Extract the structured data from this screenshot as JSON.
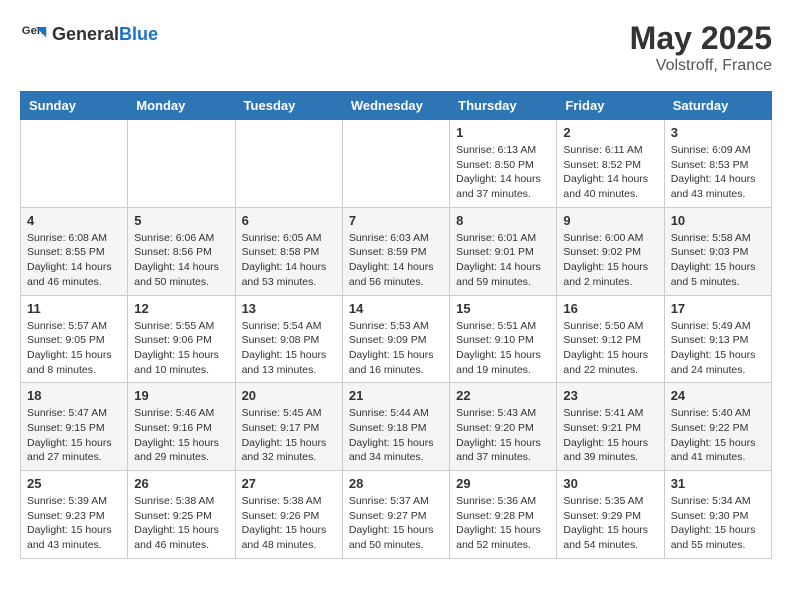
{
  "header": {
    "logo_general": "General",
    "logo_blue": "Blue",
    "month": "May 2025",
    "location": "Volstroff, France"
  },
  "weekdays": [
    "Sunday",
    "Monday",
    "Tuesday",
    "Wednesday",
    "Thursday",
    "Friday",
    "Saturday"
  ],
  "weeks": [
    [
      {
        "day": "",
        "info": ""
      },
      {
        "day": "",
        "info": ""
      },
      {
        "day": "",
        "info": ""
      },
      {
        "day": "",
        "info": ""
      },
      {
        "day": "1",
        "info": "Sunrise: 6:13 AM\nSunset: 8:50 PM\nDaylight: 14 hours and 37 minutes."
      },
      {
        "day": "2",
        "info": "Sunrise: 6:11 AM\nSunset: 8:52 PM\nDaylight: 14 hours and 40 minutes."
      },
      {
        "day": "3",
        "info": "Sunrise: 6:09 AM\nSunset: 8:53 PM\nDaylight: 14 hours and 43 minutes."
      }
    ],
    [
      {
        "day": "4",
        "info": "Sunrise: 6:08 AM\nSunset: 8:55 PM\nDaylight: 14 hours and 46 minutes."
      },
      {
        "day": "5",
        "info": "Sunrise: 6:06 AM\nSunset: 8:56 PM\nDaylight: 14 hours and 50 minutes."
      },
      {
        "day": "6",
        "info": "Sunrise: 6:05 AM\nSunset: 8:58 PM\nDaylight: 14 hours and 53 minutes."
      },
      {
        "day": "7",
        "info": "Sunrise: 6:03 AM\nSunset: 8:59 PM\nDaylight: 14 hours and 56 minutes."
      },
      {
        "day": "8",
        "info": "Sunrise: 6:01 AM\nSunset: 9:01 PM\nDaylight: 14 hours and 59 minutes."
      },
      {
        "day": "9",
        "info": "Sunrise: 6:00 AM\nSunset: 9:02 PM\nDaylight: 15 hours and 2 minutes."
      },
      {
        "day": "10",
        "info": "Sunrise: 5:58 AM\nSunset: 9:03 PM\nDaylight: 15 hours and 5 minutes."
      }
    ],
    [
      {
        "day": "11",
        "info": "Sunrise: 5:57 AM\nSunset: 9:05 PM\nDaylight: 15 hours and 8 minutes."
      },
      {
        "day": "12",
        "info": "Sunrise: 5:55 AM\nSunset: 9:06 PM\nDaylight: 15 hours and 10 minutes."
      },
      {
        "day": "13",
        "info": "Sunrise: 5:54 AM\nSunset: 9:08 PM\nDaylight: 15 hours and 13 minutes."
      },
      {
        "day": "14",
        "info": "Sunrise: 5:53 AM\nSunset: 9:09 PM\nDaylight: 15 hours and 16 minutes."
      },
      {
        "day": "15",
        "info": "Sunrise: 5:51 AM\nSunset: 9:10 PM\nDaylight: 15 hours and 19 minutes."
      },
      {
        "day": "16",
        "info": "Sunrise: 5:50 AM\nSunset: 9:12 PM\nDaylight: 15 hours and 22 minutes."
      },
      {
        "day": "17",
        "info": "Sunrise: 5:49 AM\nSunset: 9:13 PM\nDaylight: 15 hours and 24 minutes."
      }
    ],
    [
      {
        "day": "18",
        "info": "Sunrise: 5:47 AM\nSunset: 9:15 PM\nDaylight: 15 hours and 27 minutes."
      },
      {
        "day": "19",
        "info": "Sunrise: 5:46 AM\nSunset: 9:16 PM\nDaylight: 15 hours and 29 minutes."
      },
      {
        "day": "20",
        "info": "Sunrise: 5:45 AM\nSunset: 9:17 PM\nDaylight: 15 hours and 32 minutes."
      },
      {
        "day": "21",
        "info": "Sunrise: 5:44 AM\nSunset: 9:18 PM\nDaylight: 15 hours and 34 minutes."
      },
      {
        "day": "22",
        "info": "Sunrise: 5:43 AM\nSunset: 9:20 PM\nDaylight: 15 hours and 37 minutes."
      },
      {
        "day": "23",
        "info": "Sunrise: 5:41 AM\nSunset: 9:21 PM\nDaylight: 15 hours and 39 minutes."
      },
      {
        "day": "24",
        "info": "Sunrise: 5:40 AM\nSunset: 9:22 PM\nDaylight: 15 hours and 41 minutes."
      }
    ],
    [
      {
        "day": "25",
        "info": "Sunrise: 5:39 AM\nSunset: 9:23 PM\nDaylight: 15 hours and 43 minutes."
      },
      {
        "day": "26",
        "info": "Sunrise: 5:38 AM\nSunset: 9:25 PM\nDaylight: 15 hours and 46 minutes."
      },
      {
        "day": "27",
        "info": "Sunrise: 5:38 AM\nSunset: 9:26 PM\nDaylight: 15 hours and 48 minutes."
      },
      {
        "day": "28",
        "info": "Sunrise: 5:37 AM\nSunset: 9:27 PM\nDaylight: 15 hours and 50 minutes."
      },
      {
        "day": "29",
        "info": "Sunrise: 5:36 AM\nSunset: 9:28 PM\nDaylight: 15 hours and 52 minutes."
      },
      {
        "day": "30",
        "info": "Sunrise: 5:35 AM\nSunset: 9:29 PM\nDaylight: 15 hours and 54 minutes."
      },
      {
        "day": "31",
        "info": "Sunrise: 5:34 AM\nSunset: 9:30 PM\nDaylight: 15 hours and 55 minutes."
      }
    ]
  ]
}
